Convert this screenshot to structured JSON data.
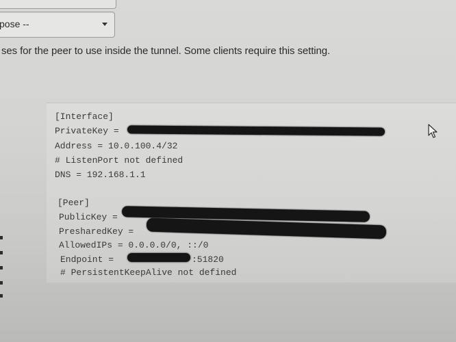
{
  "form": {
    "select_value": "pose --",
    "help_text": "ses for the peer to use inside the tunnel. Some clients require this setting."
  },
  "config": {
    "interface_header": "[Interface]",
    "private_key_label": "PrivateKey =",
    "address_line": "Address = 10.0.100.4/32",
    "listen_port_line": "# ListenPort not defined",
    "dns_line": "DNS = 192.168.1.1",
    "peer_header": "[Peer]",
    "public_key_label": "PublicKey =",
    "preshared_key_label": "PresharedKey =",
    "allowed_ips_line": "AllowedIPs = 0.0.0.0/0, ::/0",
    "endpoint_label": "Endpoint =",
    "endpoint_port": ":51820",
    "keepalive_line": "# PersistentKeepAlive not defined"
  },
  "icons": {
    "select_arrow": "chevron-down-icon",
    "cursor": "mouse-pointer-icon"
  }
}
